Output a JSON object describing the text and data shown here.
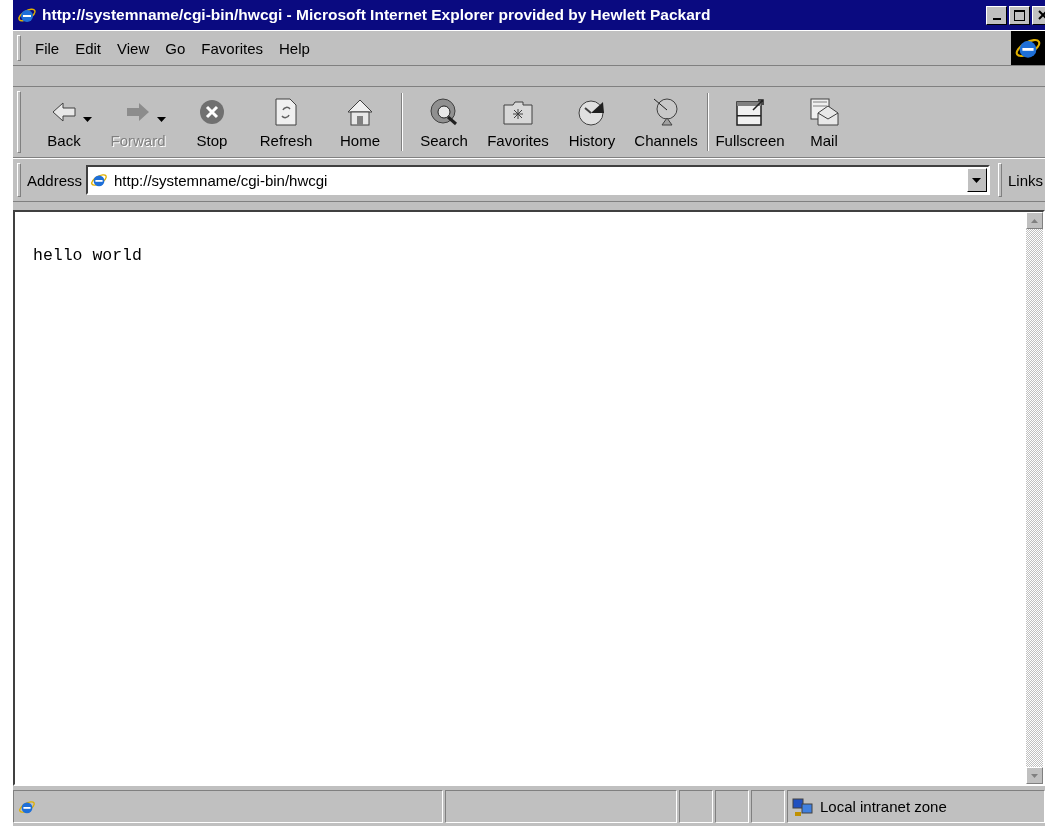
{
  "window": {
    "title": "http://systemname/cgi-bin/hwcgi - Microsoft Internet Explorer provided by Hewlett Packard"
  },
  "menu": [
    "File",
    "Edit",
    "View",
    "Go",
    "Favorites",
    "Help"
  ],
  "toolbar": {
    "groups": [
      [
        {
          "label": "Back",
          "disabled": false,
          "has_menu": true
        },
        {
          "label": "Forward",
          "disabled": true,
          "has_menu": true
        },
        {
          "label": "Stop",
          "disabled": false,
          "has_menu": false
        },
        {
          "label": "Refresh",
          "disabled": false,
          "has_menu": false
        },
        {
          "label": "Home",
          "disabled": false,
          "has_menu": false
        }
      ],
      [
        {
          "label": "Search",
          "disabled": false,
          "has_menu": false
        },
        {
          "label": "Favorites",
          "disabled": false,
          "has_menu": false
        },
        {
          "label": "History",
          "disabled": false,
          "has_menu": false
        },
        {
          "label": "Channels",
          "disabled": false,
          "has_menu": false
        }
      ],
      [
        {
          "label": "Fullscreen",
          "disabled": false,
          "has_menu": false
        },
        {
          "label": "Mail",
          "disabled": false,
          "has_menu": false
        }
      ]
    ]
  },
  "address_bar": {
    "label": "Address",
    "value": "http://systemname/cgi-bin/hwcgi",
    "links_label": "Links"
  },
  "page": {
    "text": "hello world"
  },
  "status_bar": {
    "zone": "Local intranet zone"
  }
}
